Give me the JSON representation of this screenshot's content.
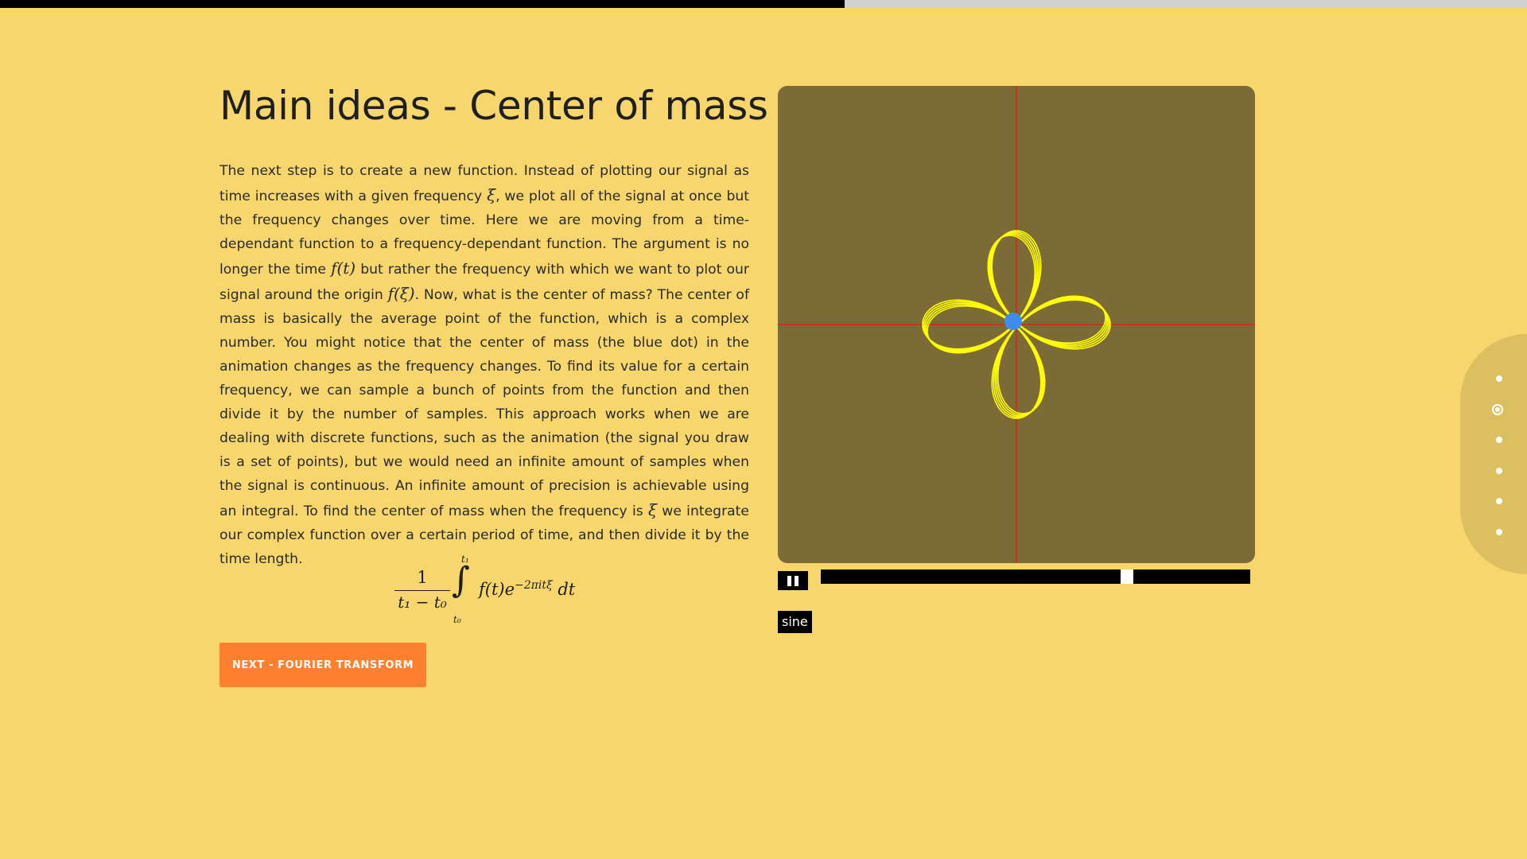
{
  "presentation": {
    "progress": 0.553,
    "slide_count": 6,
    "active_slide_index": 1
  },
  "slide": {
    "title": "Main ideas - Center of mass",
    "paragraph": {
      "t1": "The next step is to create a new function. Instead of plotting our signal as time increases with a given frequency ",
      "m1": "ξ",
      "t2": ", we plot all of the signal at once but the frequency changes over time. Here we are moving from a time-dependant function to a frequency-dependant function. The argument is no longer the time ",
      "m2": "f(t)",
      "t3": " but rather the frequency with which we want to plot our signal around the origin ",
      "m3": "f(ξ)",
      "t4": ". Now, what is the center of mass? The center of mass is basically the average point of the function, which is a complex number. You might notice that the center of mass (the blue dot) in the animation changes as the frequency changes. To find its value for a certain frequency, we can sample a bunch of points from the function and then divide it by the number of samples. This approach works when we are dealing with discrete functions, such as the animation (the signal you draw is a set of points), but we would need an infinite amount of samples when the signal is continuous. An infinite amount of precision is achievable using an integral. To find the center of mass when the frequency is ",
      "m4": "ξ",
      "t5": " we integrate our complex function over a certain period of time, and then divide it by the time length."
    },
    "formula": {
      "numerator": "1",
      "denominator": "t₁ − t₀",
      "upper_limit": "t₁",
      "lower_limit": "t₀",
      "integral": "∫",
      "integrand": "f(t)e",
      "exponent": "−2πitξ",
      "differential": " dt"
    },
    "next_button_label": "NEXT - FOURIER TRANSFORM"
  },
  "animation": {
    "background_color": "#7c6b37",
    "axis_color": "#c8321e",
    "curve_color": "#ffff00",
    "center_of_mass_color": "#3d8cf0",
    "slider_value": 0.72,
    "pause_icon": "pause-icon",
    "waveform_label": "sine"
  }
}
